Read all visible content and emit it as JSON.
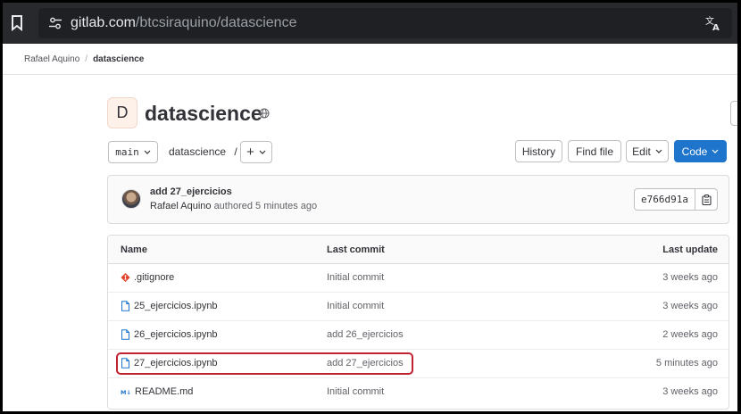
{
  "browser": {
    "url_host": "gitlab.com",
    "url_path": "/btcsiraquino/datascience"
  },
  "breadcrumb": {
    "owner": "Rafael Aquino",
    "separator": "/",
    "project": "datascience"
  },
  "project": {
    "avatar_letter": "D",
    "name": "datascience",
    "visibility_icon": "globe-icon"
  },
  "toolbar": {
    "branch": "main",
    "path": "datascience",
    "path_separator": "/",
    "add_label": "+",
    "history_label": "History",
    "find_file_label": "Find file",
    "edit_label": "Edit",
    "code_label": "Code"
  },
  "commit": {
    "title": "add 27_ejercicios",
    "author": "Rafael Aquino",
    "authored_text": "authored 5 minutes ago",
    "sha": "e766d91a"
  },
  "files": {
    "headers": {
      "name": "Name",
      "last_commit": "Last commit",
      "last_update": "Last update"
    },
    "rows": [
      {
        "name": ".gitignore",
        "icon": "git-icon",
        "last_commit": "Initial commit",
        "last_update": "3 weeks ago"
      },
      {
        "name": "25_ejercicios.ipynb",
        "icon": "file-icon",
        "last_commit": "Initial commit",
        "last_update": "3 weeks ago"
      },
      {
        "name": "26_ejercicios.ipynb",
        "icon": "file-icon",
        "last_commit": "add 26_ejercicios",
        "last_update": "2 weeks ago"
      },
      {
        "name": "27_ejercicios.ipynb",
        "icon": "file-icon",
        "last_commit": "add 27_ejercicios",
        "last_update": "5 minutes ago"
      },
      {
        "name": "README.md",
        "icon": "markdown-icon",
        "last_commit": "Initial commit",
        "last_update": "3 weeks ago"
      }
    ]
  },
  "colors": {
    "primary": "#1f75cb",
    "highlight": "#c0222f",
    "git_orange": "#e24329"
  }
}
